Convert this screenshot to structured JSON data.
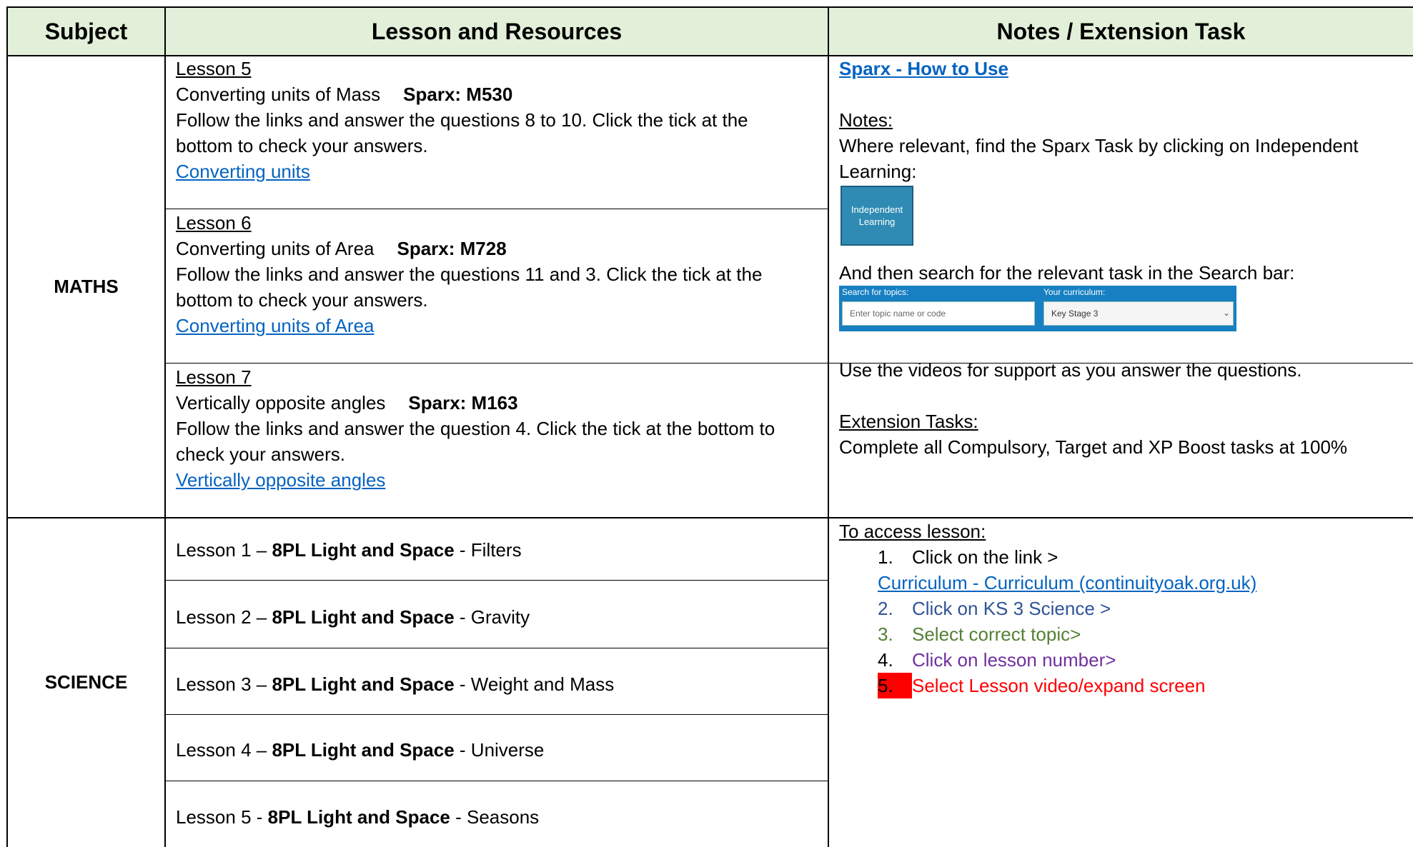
{
  "header": {
    "subject": "Subject",
    "lesson": "Lesson and Resources",
    "notes": "Notes / Extension Task"
  },
  "maths": {
    "subject": "MATHS",
    "lessons": [
      {
        "title": "Lesson 5",
        "topic": "Converting units of Mass",
        "sparx": "Sparx: M530",
        "instruction_line1": "Follow the links and answer the questions 8 to 10. Click the tick at the",
        "instruction_line2": "bottom to check your answers.",
        "link": "Converting units"
      },
      {
        "title": "Lesson 6",
        "topic": "Converting units of Area",
        "sparx": "Sparx: M728",
        "instruction_line1": "Follow the links and answer the questions 11 and 3. Click the tick at the",
        "instruction_line2": "bottom to check your answers.",
        "link": "Converting units of Area"
      },
      {
        "title": "Lesson 7",
        "topic": "Vertically opposite angles",
        "sparx": "Sparx: M163",
        "instruction_line1": "Follow the links and answer the question 4. Click the tick at the bottom to",
        "instruction_line2": "check your answers.",
        "link": "Vertically opposite angles"
      }
    ],
    "notes": {
      "sparx_link": "Sparx - How to Use",
      "notes_heading": "Notes:",
      "notes_line1": "Where relevant, find the Sparx Task by clicking on Independent",
      "notes_line2": "Learning:",
      "il_button": "Independent Learning",
      "search_line": "And then search for the relevant task in the Search bar:",
      "search_label": "Search for topics:",
      "search_placeholder": "Enter topic name or code",
      "curriculum_label": "Your curriculum:",
      "curriculum_value": "Key Stage 3",
      "videos_line": "Use the videos for support as you answer the questions.",
      "extension_heading": "Extension Tasks:",
      "extension_line": "Complete all Compulsory, Target and XP Boost tasks at 100%"
    }
  },
  "science": {
    "subject": "SCIENCE",
    "lessons": [
      {
        "prefix": "Lesson 1 – ",
        "unit": "8PL Light and Space",
        "suffix": " - Filters"
      },
      {
        "prefix": "Lesson 2 – ",
        "unit": "8PL Light and Space",
        "suffix": " - Gravity"
      },
      {
        "prefix": "Lesson 3 – ",
        "unit": "8PL Light and Space",
        "suffix": " - Weight and Mass"
      },
      {
        "prefix": "Lesson 4 – ",
        "unit": "8PL Light and Space",
        "suffix": " - Universe"
      },
      {
        "prefix": "Lesson 5 - ",
        "unit": "8PL Light and Space",
        "suffix": " - Seasons"
      }
    ],
    "notes": {
      "access_heading": "To access lesson:",
      "step1": "Click on the link >",
      "link": "Curriculum - Curriculum (continuityoak.org.uk)",
      "step2": "Click on KS 3 Science >",
      "step3": "Select correct topic>",
      "step4": "Click on lesson number>",
      "step5": "Select Lesson video/expand screen",
      "n1": "1.",
      "n2": "2.",
      "n3": "3.",
      "n4": "4.",
      "n5": "5."
    }
  },
  "colors": {
    "header_bg": "#e2efd9",
    "link": "#0563c1",
    "step2": "#2f5496",
    "step3": "#538135",
    "step4": "#7030a0",
    "step5": "#ff0000"
  }
}
